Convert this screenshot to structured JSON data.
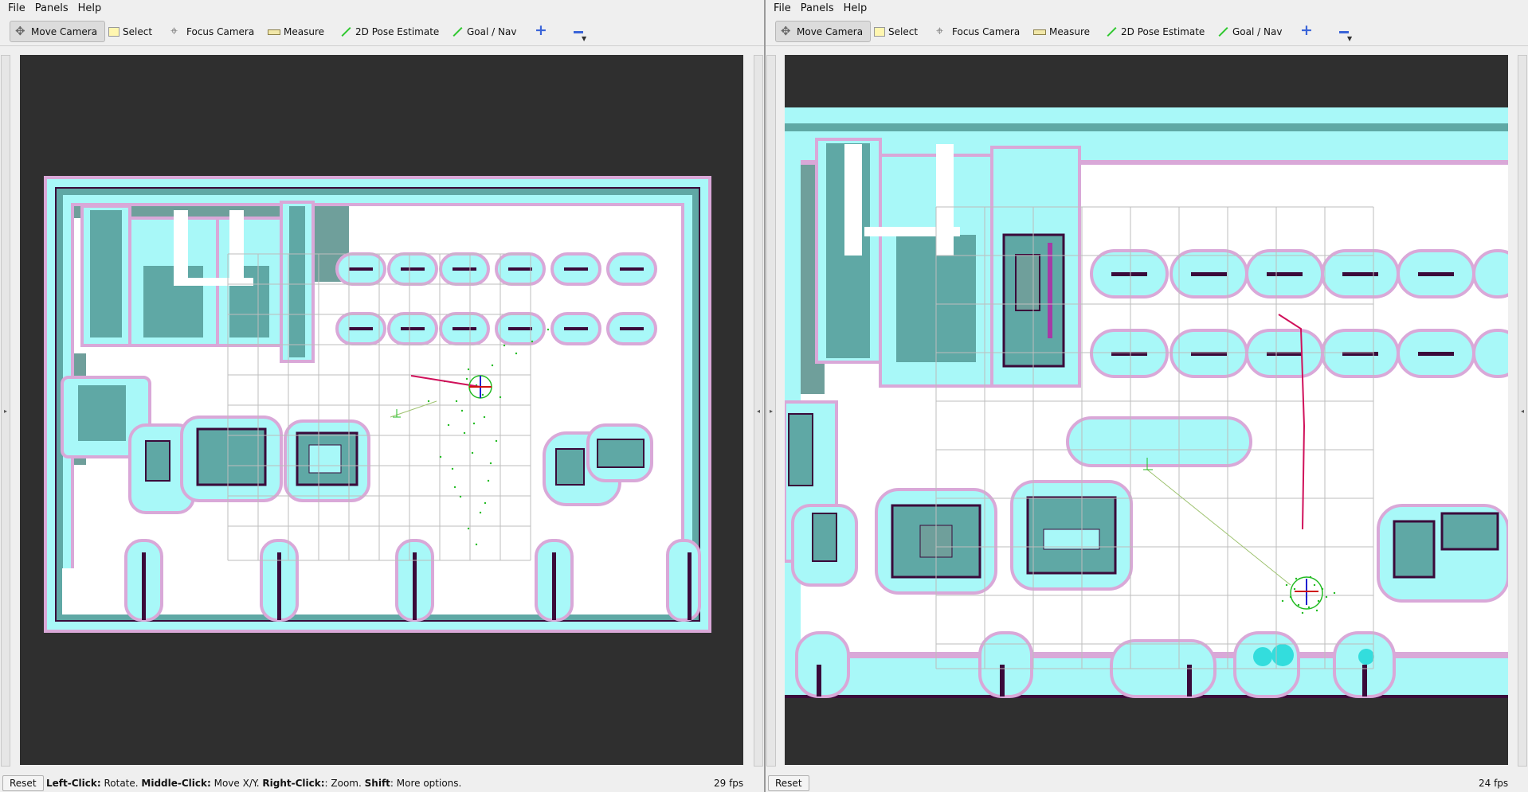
{
  "left": {
    "menu": [
      "File",
      "Panels",
      "Help"
    ],
    "tools": [
      {
        "label": "Move Camera",
        "icon": "move-icon"
      },
      {
        "label": "Select",
        "icon": "select-icon"
      },
      {
        "label": "Focus Camera",
        "icon": "focus-icon"
      },
      {
        "label": "Measure",
        "icon": "ruler-icon"
      },
      {
        "label": "2D Pose Estimate",
        "icon": "green-arrow-icon"
      },
      {
        "label": "Goal / Nav",
        "icon": "green-arrow-icon"
      }
    ],
    "status": {
      "reset": "Reset",
      "hint_parts": [
        {
          "t": "Left-Click:",
          "b": true
        },
        {
          "t": " Rotate. ",
          "b": false
        },
        {
          "t": "Middle-Click:",
          "b": true
        },
        {
          "t": " Move X/Y. ",
          "b": false
        },
        {
          "t": "Right-Click:",
          "b": true
        },
        {
          "t": ": Zoom. ",
          "b": false
        },
        {
          "t": "Shift",
          "b": true
        },
        {
          "t": ": More options.",
          "b": false
        }
      ],
      "fps": "29 fps"
    }
  },
  "right": {
    "menu": [
      "File",
      "Panels",
      "Help"
    ],
    "tools": [
      {
        "label": "Move Camera",
        "icon": "move-icon"
      },
      {
        "label": "Select",
        "icon": "select-icon"
      },
      {
        "label": "Focus Camera",
        "icon": "focus-icon"
      },
      {
        "label": "Measure",
        "icon": "ruler-icon"
      },
      {
        "label": "2D Pose Estimate",
        "icon": "green-arrow-icon"
      },
      {
        "label": "Goal / Nav",
        "icon": "green-arrow-icon"
      }
    ],
    "status": {
      "reset": "Reset",
      "fps": "24 fps"
    }
  },
  "colors": {
    "viewport_bg": "#2f2f2f",
    "free_space": "#ffffff",
    "unknown": "#6f9f9b",
    "inflation": "#a8f8f8",
    "cost_halo": "#d9a8d8",
    "obstacle_core": "#5fa8a5",
    "wall": "#3a0a3a",
    "plan": "#d0105a",
    "particles": "#22bb22",
    "grid": "#bdbdbd"
  }
}
